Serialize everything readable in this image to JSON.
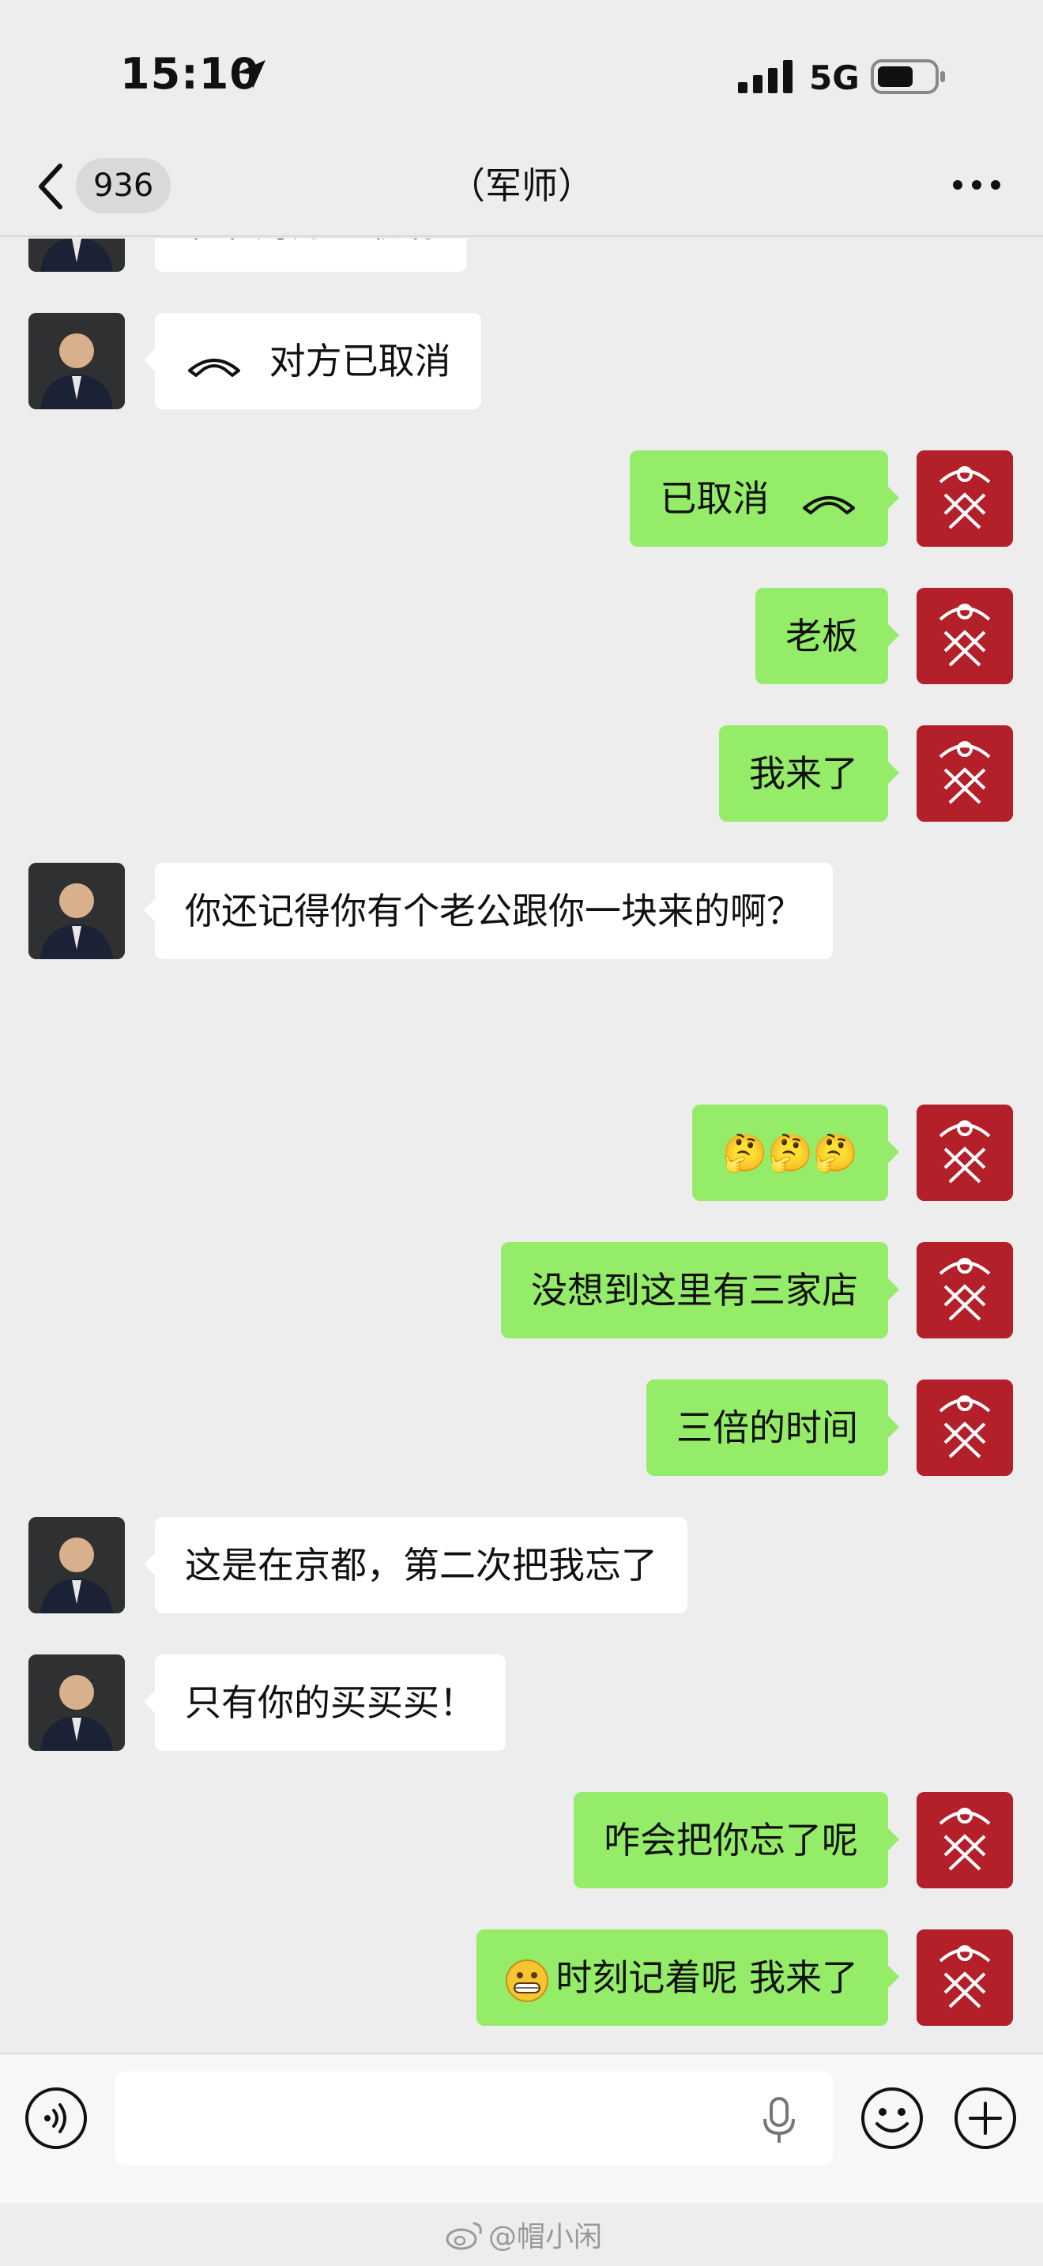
{
  "status_bar": {
    "time": "15:10",
    "network": "5G"
  },
  "nav": {
    "unread_count": "936",
    "title": "（军师）"
  },
  "messages": [
    {
      "side": "left",
      "text": "对方已取消",
      "icon": "call-end-icon",
      "partial": true
    },
    {
      "side": "left",
      "text": "对方已取消",
      "icon": "call-end-icon"
    },
    {
      "side": "right",
      "text": "已取消",
      "icon": "call-end-icon"
    },
    {
      "side": "right",
      "text": "老板"
    },
    {
      "side": "right",
      "text": "我来了"
    },
    {
      "side": "left",
      "text": "你还记得你有个老公跟你一块来的啊？"
    },
    {
      "side": "right",
      "text": "🤔🤔🤔"
    },
    {
      "side": "right",
      "text": "没想到这里有三家店"
    },
    {
      "side": "right",
      "text": "三倍的时间"
    },
    {
      "side": "left",
      "text": "这是在京都，第二次把我忘了"
    },
    {
      "side": "left",
      "text": "只有你的买买买！"
    },
    {
      "side": "right",
      "text": "咋会把你忘了呢"
    },
    {
      "side": "right",
      "text": "时刻记着呢 我来了",
      "emoji": "grinning-face-icon"
    }
  ],
  "input": {
    "placeholder": ""
  },
  "watermark": {
    "text": "@帽小闲"
  },
  "colors": {
    "background": "#ededed",
    "bubble_self": "#95ec69",
    "bubble_other": "#ffffff",
    "avatar_self": "#b3202a"
  }
}
